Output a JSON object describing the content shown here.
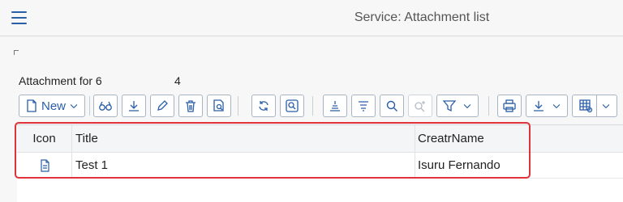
{
  "header": {
    "title": "Service: Attachment list"
  },
  "attachment_label": {
    "prefix": "Attachment for 6",
    "suffix": "4"
  },
  "toolbar": {
    "new_label": "New",
    "icons": [
      "new-document-icon",
      "dropdown-chevron-icon",
      "glasses-icon",
      "download-icon",
      "pencil-icon",
      "trash-icon",
      "document-preview-icon",
      "refresh-icon",
      "zoom-search-icon",
      "align-center-icon",
      "align-text-icon",
      "search-icon",
      "search-next-icon",
      "filter-icon",
      "print-icon",
      "export-icon",
      "table-settings-icon"
    ]
  },
  "grid": {
    "columns": [
      "Icon",
      "Title",
      "CreatrName"
    ],
    "rows": [
      {
        "icon": "document-icon",
        "title": "Test 1",
        "creator": "Isuru Fernando"
      }
    ]
  },
  "colors": {
    "accent": "#2a5ea8",
    "highlight": "#e0323a"
  }
}
